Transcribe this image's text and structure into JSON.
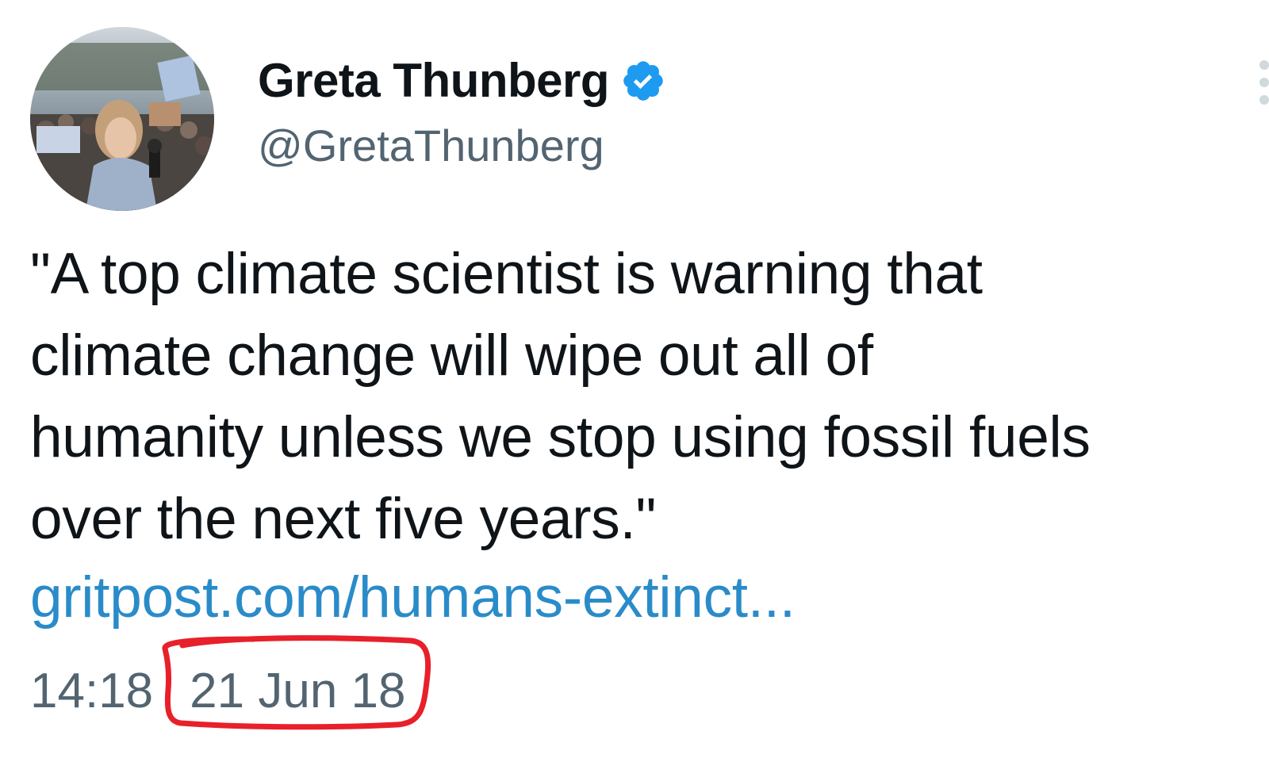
{
  "author": {
    "display_name": "Greta Thunberg",
    "handle": "@GretaThunberg",
    "verified": true,
    "verified_icon": "verified-badge-icon",
    "avatar_icon": "profile-photo"
  },
  "tweet": {
    "text_lines": [
      "\"A top climate scientist is warning that",
      "climate change will wipe out all of",
      "humanity unless we stop using fossil fuels",
      "over the next five years.\""
    ],
    "link_text": "gritpost.com/humans-extinct...",
    "time": "14:18",
    "date": "21 Jun 18"
  },
  "colors": {
    "link": "#2a8bc9",
    "verified": "#1d9bf0",
    "secondary_text": "#536471",
    "annotation": "#e8202a"
  },
  "annotation": {
    "type": "hand-drawn-circle",
    "target": "date"
  }
}
